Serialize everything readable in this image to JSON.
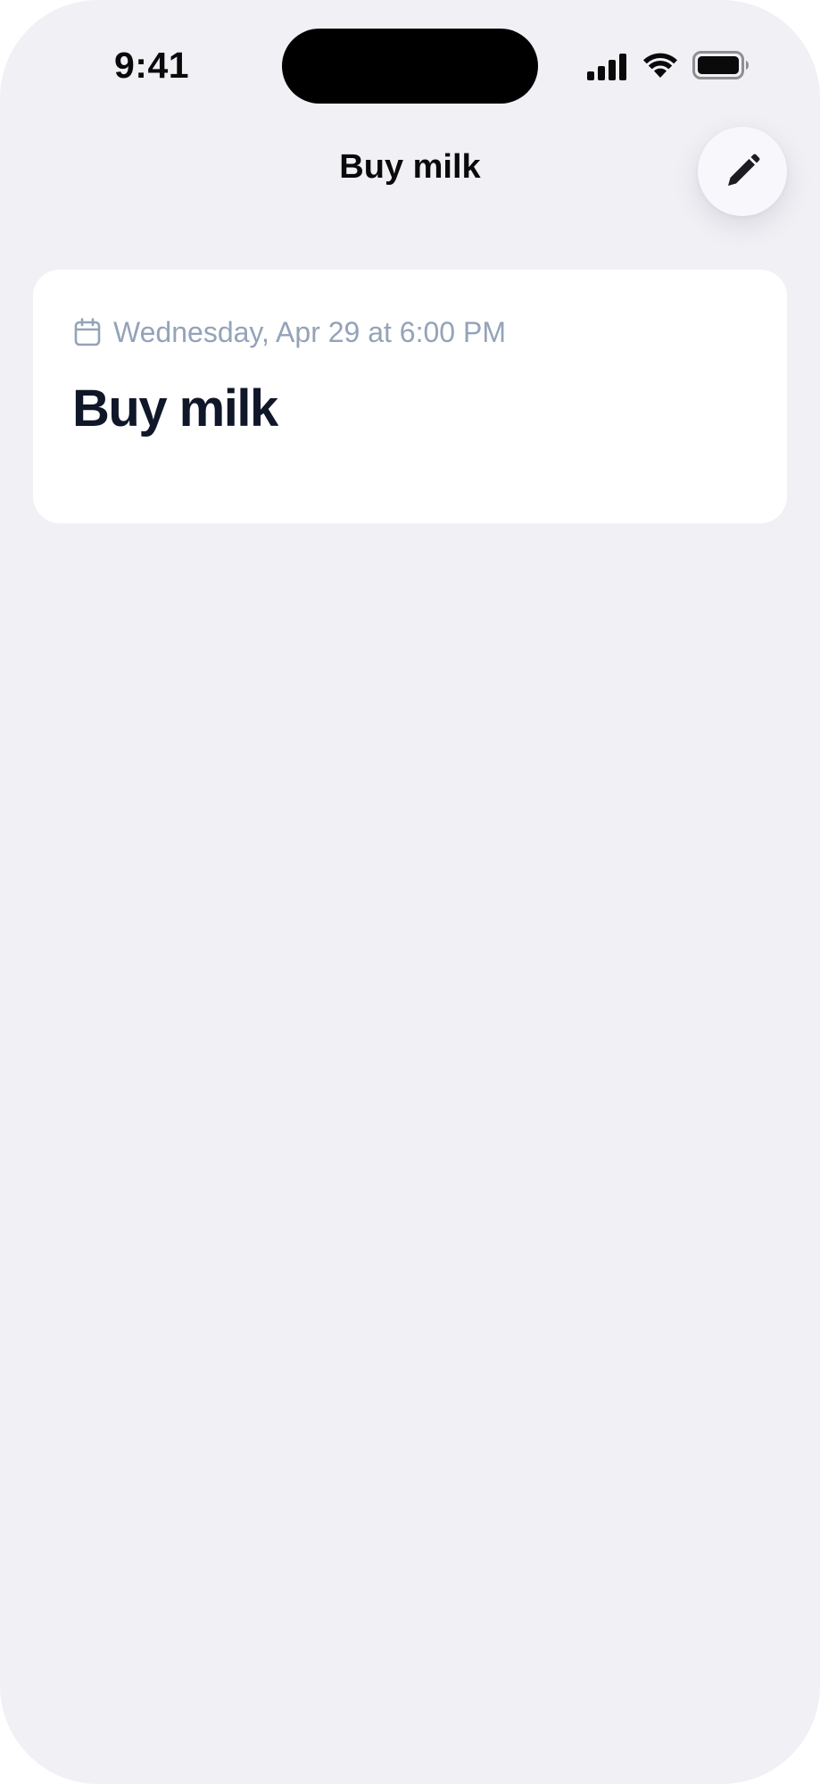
{
  "status_bar": {
    "time": "9:41",
    "icons": [
      "signal-icon",
      "wifi-icon",
      "battery-icon"
    ]
  },
  "header": {
    "title": "Buy milk",
    "edit_icon": "pencil-icon"
  },
  "card": {
    "date": "Wednesday, Apr 29 at 6:00 PM",
    "date_icon": "calendar-icon",
    "title": "Buy milk"
  },
  "colors": {
    "background": "#f1f0f5",
    "card": "#ffffff",
    "title_text": "#101729",
    "date_text": "#94a3b8"
  }
}
